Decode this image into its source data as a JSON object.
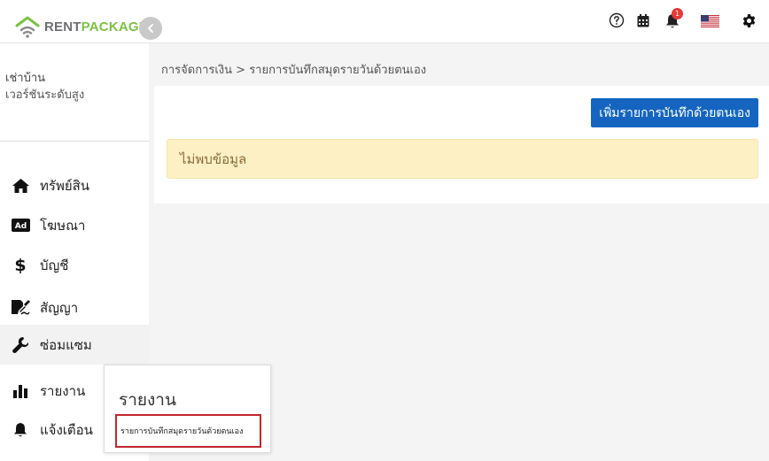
{
  "app": {
    "logo_rent": "RENT",
    "logo_package": "PACKAGE"
  },
  "topbar": {
    "icons": [
      "help-circle-icon",
      "calendar-icon",
      "bell-icon",
      "us-flag-icon",
      "gear-icon"
    ],
    "notification_count": "1",
    "colors": {
      "badge": "#e53935"
    }
  },
  "sidebar": {
    "user": {
      "role": "เช่าบ้าน",
      "level": "เวอร์ชันระดับสูง"
    },
    "items": [
      {
        "label": "ทรัพย์สิน",
        "icon": "home-icon"
      },
      {
        "label": "โฆษณา",
        "icon": "ad-icon"
      },
      {
        "label": "บัญชี",
        "icon": "dollar-icon"
      },
      {
        "label": "สัญญา",
        "icon": "contract-icon"
      },
      {
        "label": "ซ่อมแซม",
        "icon": "wrench-icon"
      },
      {
        "label": "รายงาน",
        "icon": "bar-chart-icon"
      },
      {
        "label": "แจ้งเตือน",
        "icon": "bell-icon"
      }
    ]
  },
  "flyout": {
    "title": "รายงาน",
    "item": "รายการบันทึกสมุดรายวันด้วยตนเอง"
  },
  "main": {
    "breadcrumb": "การจัดการเงิน > รายการบันทึกสมุดรายวันด้วยตนเอง",
    "add_button": "เพิ่มรายการบันทึกด้วยตนเอง",
    "empty_message": "ไม่พบข้อมูล",
    "colors": {
      "primary": "#1565c0",
      "alert_bg": "#fdf0c5",
      "alert_text": "#8a6d3b"
    }
  }
}
